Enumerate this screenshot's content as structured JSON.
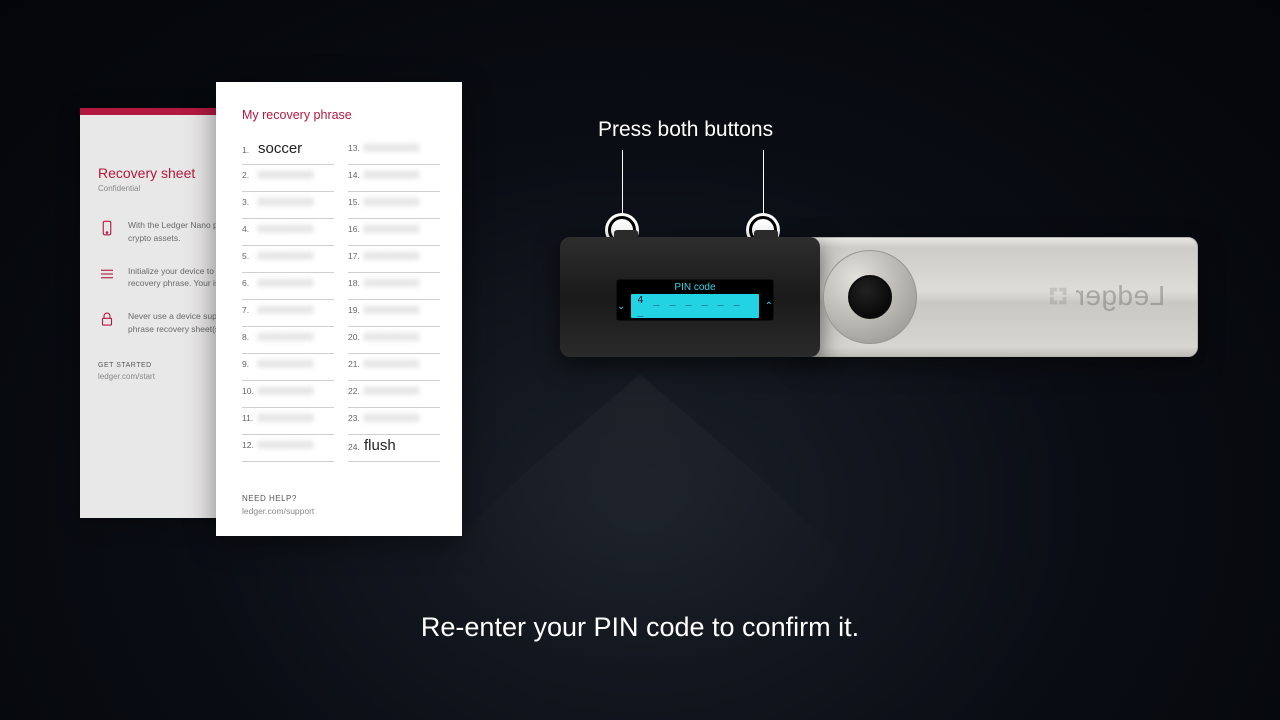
{
  "callout": {
    "label": "Press both buttons"
  },
  "device": {
    "screen_title": "PIN code",
    "pin_display": "4 _ _ _ _ _ _ _",
    "brand": "Ledger"
  },
  "instruction": "Re-enter your PIN code to confirm it.",
  "recovery_sheet": {
    "title": "Recovery sheet",
    "subtitle": "Confidential",
    "bullets": [
      "With the Ledger Nano private keys to securely crypto assets.",
      "Initialize your device to and save your confidential recovery phrase. Your is the only backup of your",
      "Never use a device supplied code or a recovery phrase recovery sheet(s) in a safe"
    ],
    "footer_label": "GET STARTED",
    "footer_link": "ledger.com/start"
  },
  "phrase_card": {
    "title": "My recovery phrase",
    "words_col1": [
      {
        "n": "1.",
        "w": "soccer",
        "clear": true
      },
      {
        "n": "2.",
        "w": "xxxxxxxx",
        "clear": false
      },
      {
        "n": "3.",
        "w": "xxxxxxxx",
        "clear": false
      },
      {
        "n": "4.",
        "w": "xxxxxxxx",
        "clear": false
      },
      {
        "n": "5.",
        "w": "xxxxxxxx",
        "clear": false
      },
      {
        "n": "6.",
        "w": "xxxxxxxx",
        "clear": false
      },
      {
        "n": "7.",
        "w": "xxxxxxxx",
        "clear": false
      },
      {
        "n": "8.",
        "w": "xxxxxxxx",
        "clear": false
      },
      {
        "n": "9.",
        "w": "xxxxxxxx",
        "clear": false
      },
      {
        "n": "10.",
        "w": "xxxxxxxx",
        "clear": false
      },
      {
        "n": "11.",
        "w": "xxxxxxxx",
        "clear": false
      },
      {
        "n": "12.",
        "w": "xxxxxxxx",
        "clear": false
      }
    ],
    "words_col2": [
      {
        "n": "13.",
        "w": "xxxxxxxx",
        "clear": false
      },
      {
        "n": "14.",
        "w": "xxxxxxxx",
        "clear": false
      },
      {
        "n": "15.",
        "w": "xxxxxxxx",
        "clear": false
      },
      {
        "n": "16.",
        "w": "xxxxxxxx",
        "clear": false
      },
      {
        "n": "17.",
        "w": "xxxxxxxx",
        "clear": false
      },
      {
        "n": "18.",
        "w": "xxxxxxxx",
        "clear": false
      },
      {
        "n": "19.",
        "w": "xxxxxxxx",
        "clear": false
      },
      {
        "n": "20.",
        "w": "xxxxxxxx",
        "clear": false
      },
      {
        "n": "21.",
        "w": "xxxxxxxx",
        "clear": false
      },
      {
        "n": "22.",
        "w": "xxxxxxxx",
        "clear": false
      },
      {
        "n": "23.",
        "w": "xxxxxxxx",
        "clear": false
      },
      {
        "n": "24.",
        "w": "flush",
        "clear": true
      }
    ],
    "help_label": "NEED HELP?",
    "help_link": "ledger.com/support"
  }
}
